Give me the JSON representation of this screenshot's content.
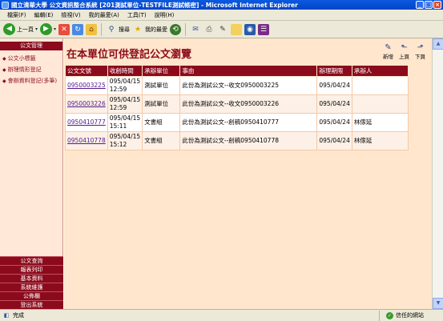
{
  "window": {
    "title": "國立清華大學 公文資訊整合系統 [201測試單位-TESTFILE測試帳密] - Microsoft Internet Explorer"
  },
  "menubar": {
    "items": [
      "檔案(F)",
      "編輯(E)",
      "檢視(V)",
      "我的最愛(A)",
      "工具(T)",
      "說明(H)"
    ]
  },
  "toolbar": {
    "back_label": "上一頁",
    "search_label": "搜尋",
    "favorites_label": "我的最愛"
  },
  "sidebar": {
    "header": "公文管理",
    "items": [
      {
        "label": "公文小標籤"
      },
      {
        "label": "辦理情形登記"
      },
      {
        "label": "會辦資料登記(多筆)"
      }
    ],
    "bottom_buttons": [
      "公文查詢",
      "報表列印",
      "基本資料",
      "系統維護",
      "公佈欄",
      "登出系統"
    ]
  },
  "main": {
    "page_title": "在本單位可供登記公文瀏覽",
    "actions": {
      "new_label": "新增",
      "prev_label": "上頁",
      "next_label": "下頁"
    },
    "table": {
      "headers": [
        "公文文號",
        "收創時間",
        "承辦單位",
        "事由",
        "辦理期限",
        "承辦人"
      ],
      "rows": [
        {
          "doc_no": "0950003225",
          "time": "095/04/15 12:59",
          "unit": "測試單位",
          "subject": "此份為測試公文--收文0950003225",
          "deadline": "095/04/24",
          "handler": ""
        },
        {
          "doc_no": "0950003226",
          "time": "095/04/15 12:59",
          "unit": "測試單位",
          "subject": "此份為測試公文--收文0950003226",
          "deadline": "095/04/24",
          "handler": ""
        },
        {
          "doc_no": "0950410777",
          "time": "095/04/15 15:11",
          "unit": "文書組",
          "subject": "此份為測試公文--創稿0950410777",
          "deadline": "095/04/24",
          "handler": "林傢延"
        },
        {
          "doc_no": "0950410778",
          "time": "095/04/15 15:12",
          "unit": "文書組",
          "subject": "此份為測試公文--創稿0950410778",
          "deadline": "095/04/24",
          "handler": "林傢延"
        }
      ]
    }
  },
  "statusbar": {
    "left_text": "完成",
    "zone_text": "信任的網站"
  },
  "colors": {
    "accent": "#8b0b1c",
    "content_bg": "#ffe6cc",
    "sidebar_bg": "#ffe8d8"
  }
}
